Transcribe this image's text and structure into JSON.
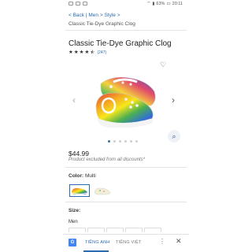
{
  "status": {
    "battery": "63%",
    "time": "20:11"
  },
  "breadcrumb": {
    "back": "< Back",
    "sep1": "|",
    "men": "Men",
    "sep2": ">",
    "style": "Style",
    "sep3": ">",
    "current": "Classic Tie-Dye Graphic Clog"
  },
  "product": {
    "title": "Classic Tie-Dye Graphic Clog",
    "rating_stars": 4.5,
    "review_count": "(247)",
    "price": "$44.99",
    "discount_note": "Product excluded from all discounts*",
    "color_label": "Color:",
    "color_value": "Multi",
    "size_label": "Size:",
    "size_gender": "Men"
  },
  "carousel": {
    "dots": 6,
    "active_dot": 0
  },
  "icons": {
    "heart": "heart-outline-icon",
    "prev": "chevron-left-icon",
    "next": "chevron-right-icon",
    "zoom": "magnify-icon",
    "more": "more-vertical-icon",
    "close": "close-icon"
  },
  "translate": {
    "tab_english": "TIẾNG ANH",
    "tab_vietnamese": "TIẾNG VIỆT",
    "g_label": "G"
  },
  "colors": {
    "link": "#2b6cb0",
    "accent": "#3a6ea5"
  }
}
